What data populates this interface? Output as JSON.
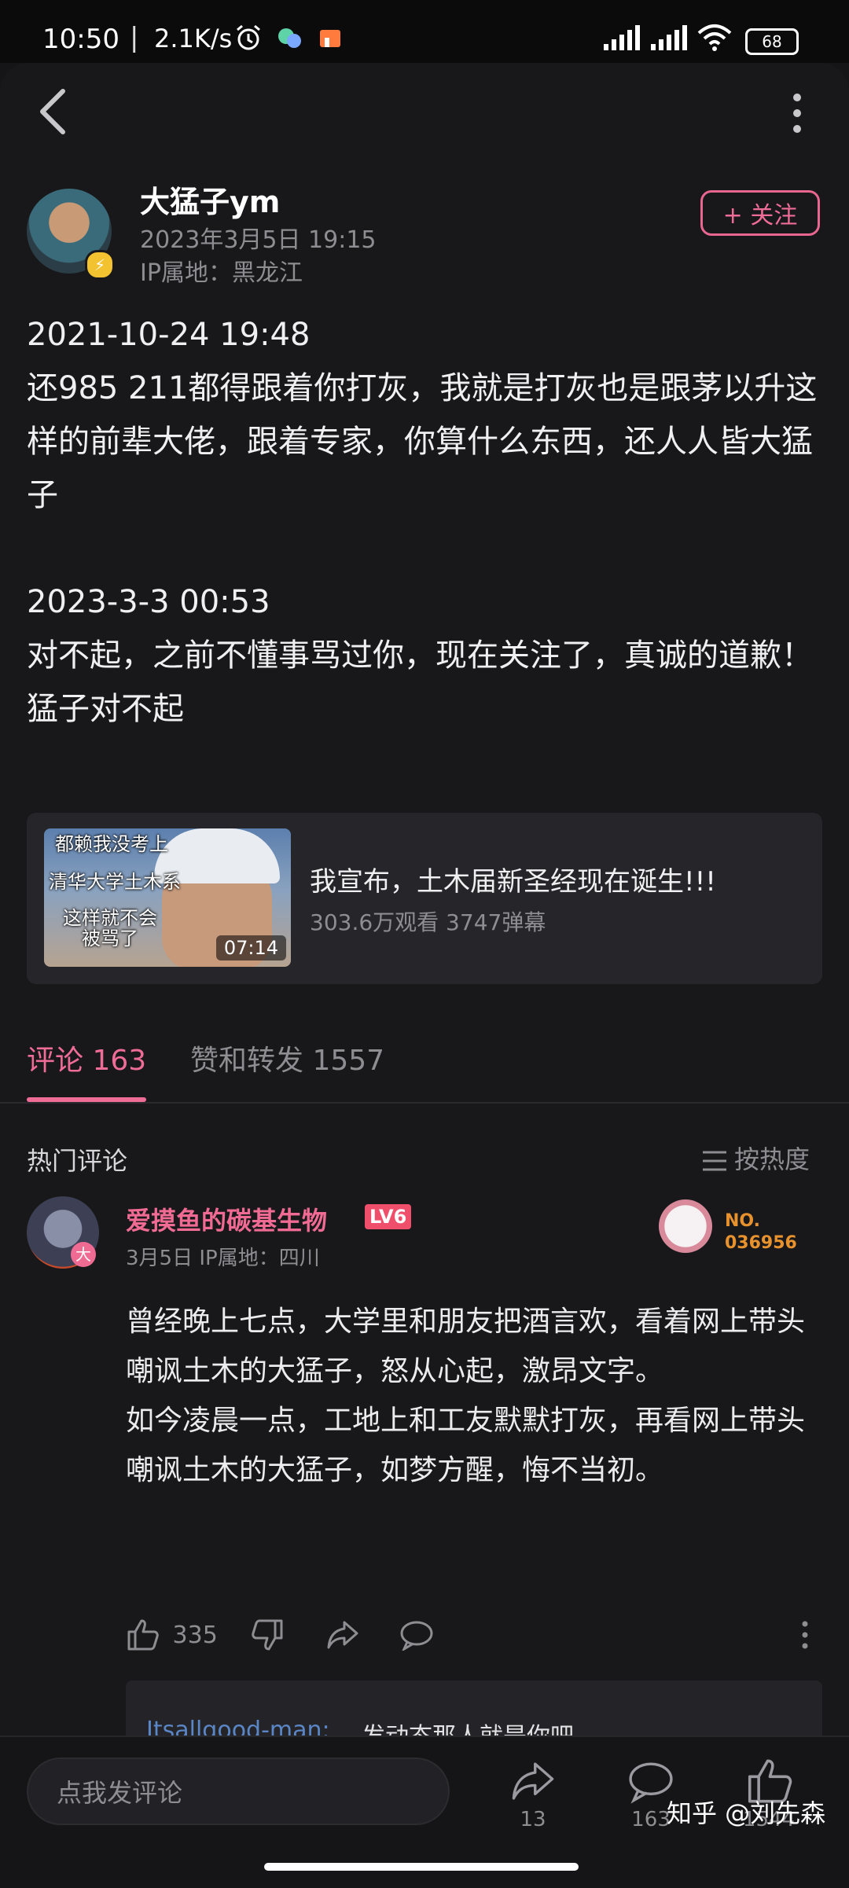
{
  "status_bar": {
    "time": "10:50",
    "separator": "|",
    "net_speed": "2.1K/s",
    "battery": "68",
    "icons": [
      "alarm-icon",
      "app-notification-icon",
      "store-icon",
      "signal-icon",
      "signal-icon",
      "wifi-icon",
      "battery-icon"
    ]
  },
  "header": {
    "back_icon": "chevron-left-icon",
    "more_icon": "more-vertical-icon"
  },
  "author": {
    "name": "大猛子ym",
    "time": "2023年3月5日 19:15",
    "ip": "IP属地：黑龙江",
    "follow_label": "+ 关注"
  },
  "post": {
    "block1_time": "2021-10-24 19:48",
    "block1_text": "还985 211都得跟着你打灰，我就是打灰也是跟茅以升这样的前辈大佬，跟着专家，你算什么东西，还人人皆大猛子",
    "block2_time": "2023-3-3 00:53",
    "block2_line1": "对不起，之前不懂事骂过你，现在关注了，真诚的道歉！",
    "block2_line2": "猛子对不起"
  },
  "video_card": {
    "thumb_text_1": "都赖我没考上",
    "thumb_text_2": "清华大学土木系",
    "thumb_text_3": "这样就不会",
    "thumb_text_4": "被骂了",
    "duration": "07:14",
    "title": "我宣布，土木届新圣经现在诞生!!!",
    "stats": "303.6万观看 3747弹幕"
  },
  "tabs": [
    {
      "label": "评论 163",
      "active": true
    },
    {
      "label": "赞和转发 1557",
      "active": false
    }
  ],
  "comments_section": {
    "title": "热门评论",
    "sort_label": "按热度"
  },
  "comment": {
    "username": "爱摸鱼的碳基生物",
    "level": "LV6",
    "avatar_badge": "大",
    "meta": "3月5日  IP属地：四川",
    "fan_no_label": "NO.",
    "fan_no_value": "036956",
    "para1": "曾经晚上七点，大学里和朋友把酒言欢，看着网上带头嘲讽土木的大猛子，怒从心起，激昂文字。",
    "para2": "如今凌晨一点，工地上和工友默默打灰，再看网上带头嘲讽土木的大猛子，如梦方醒，悔不当初。",
    "likes": "335",
    "reply_user": "Itsallgood-man:",
    "reply_text": "发动态那人就是你吧"
  },
  "bottom_bar": {
    "input_placeholder": "点我发评论",
    "share_count": "13",
    "comment_count": "163",
    "like_count": "1544"
  },
  "watermark": "知乎 @刘先森",
  "colors": {
    "accent": "#ef6c96",
    "background": "#18181b",
    "muted_text": "#8d8d92",
    "reply_link": "#5a86c6"
  }
}
